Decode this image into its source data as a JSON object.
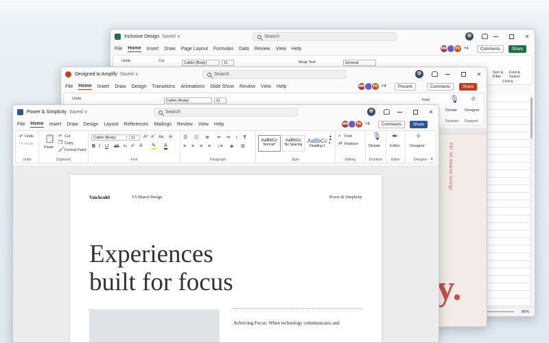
{
  "excel": {
    "title": "Inclusive Design",
    "saved": "Saved ∨",
    "search": "Search",
    "menu": [
      "File",
      "Home",
      "Insert",
      "Draw",
      "Page Layout",
      "Formulas",
      "Data",
      "Review",
      "View",
      "Help"
    ],
    "collab": [
      "MM",
      "PS"
    ],
    "plus": "+4",
    "comments": "Comments",
    "share": "Share",
    "ribbon": {
      "undo": "Undo",
      "cut": "Cut",
      "font": "Calibri (Body)",
      "size": "11",
      "wrap": "Wrap Text",
      "format": "General",
      "sort": "Sort &\nFilter",
      "find": "Find &\nSelect",
      "editing": "Editing"
    },
    "zoom": "86%"
  },
  "ppt": {
    "title": "Designed to Amplify",
    "saved": "Saved ∨",
    "search": "Search",
    "menu": [
      "File",
      "Home",
      "Insert",
      "Draw",
      "Design",
      "Transitions",
      "Animations",
      "Slide Show",
      "Review",
      "View",
      "Help"
    ],
    "collab": [
      "MM",
      "PS"
    ],
    "plus": "+4",
    "present": "Present",
    "comments": "Comments",
    "share": "Share",
    "ribbon": {
      "undo": "Undo",
      "font": "Calibri (Body)",
      "size": "11",
      "find": "Find",
      "dictate": "Dictate",
      "designer": "Designer",
      "dictation_label": "Dictation",
      "designer_label": "Designer"
    },
    "side_text": "PE!  VA Shared Design",
    "big_letters": "fy."
  },
  "word": {
    "title": "Power & Simplicity",
    "saved": "Saved ∨",
    "search": "Search",
    "menu": [
      "File",
      "Home",
      "Insert",
      "Draw",
      "Design",
      "Layout",
      "References",
      "Mailings",
      "Review",
      "View",
      "Help"
    ],
    "collab": [
      "MM",
      "PS"
    ],
    "plus": "+4",
    "comments": "Comments",
    "share": "Share",
    "ribbon": {
      "undo": "Undo",
      "redo": "Redo",
      "paste": "Paste",
      "cut": "Cut",
      "copy": "Copy",
      "format_painter": "Format Paint",
      "font": "Calibri (Body)",
      "size": "11",
      "styles": [
        {
          "preview": "AaBbCc",
          "name": "Normal*"
        },
        {
          "preview": "AaBbCc",
          "name": "No Spacing"
        },
        {
          "preview": "AaBbCc",
          "name": "Heading 1"
        }
      ],
      "find": "Find",
      "replace": "Replace",
      "dictate": "Dictate",
      "editor": "Editor",
      "designer": "Designer",
      "groups": [
        "Undo",
        "Clipboard",
        "Font",
        "Paragraph",
        "Style",
        "Editing",
        "Dictation",
        "Editor",
        "Designer"
      ]
    },
    "doc": {
      "logo": "VanArsdel",
      "header_mid": "VA Shared Design",
      "header_right": "Power & Simplicity",
      "headline_1": "Experiences",
      "headline_2": "built for focus",
      "body_start": "Achieving Focus: When technology communicates and"
    }
  },
  "colors": {
    "word": "#2b579a",
    "excel": "#1e7145",
    "ppt": "#c43e1c",
    "accent_red": "#c0504d"
  }
}
